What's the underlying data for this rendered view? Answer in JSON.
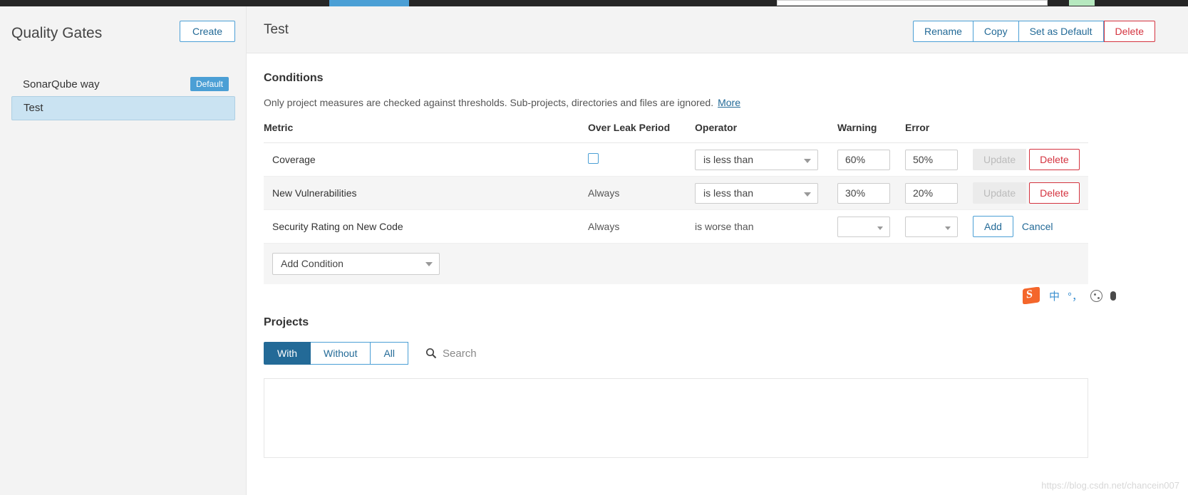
{
  "topbar": {
    "active_tab_name": "quality-gates-tab",
    "search_placeholder": "",
    "accent_blue": "#4b9fd5",
    "bar_color": "#262626"
  },
  "sidebar": {
    "title": "Quality Gates",
    "create_label": "Create",
    "gates": [
      {
        "name": "SonarQube way",
        "badge": "Default",
        "selected": false
      },
      {
        "name": "Test",
        "badge": "",
        "selected": true
      }
    ]
  },
  "header": {
    "gate_name": "Test",
    "actions": [
      {
        "label": "Rename",
        "style": "default"
      },
      {
        "label": "Copy",
        "style": "default"
      },
      {
        "label": "Set as Default",
        "style": "default"
      },
      {
        "label": "Delete",
        "style": "danger"
      }
    ]
  },
  "conditions": {
    "title": "Conditions",
    "description": "Only project measures are checked against thresholds. Sub-projects, directories and files are ignored.",
    "more_link": "More",
    "columns": {
      "metric": "Metric",
      "leak": "Over Leak Period",
      "operator": "Operator",
      "warning": "Warning",
      "error": "Error"
    },
    "rows": [
      {
        "metric": "Coverage",
        "leak_checkbox": true,
        "leak_checked": false,
        "leak_text": "",
        "operator": "is less than",
        "operator_editable": true,
        "warning": "60%",
        "error": "50%",
        "warning_editable": true,
        "error_editable": true,
        "primary_action": "Update",
        "primary_disabled": true,
        "secondary_action": "Delete",
        "secondary_style": "danger"
      },
      {
        "metric": "New Vulnerabilities",
        "leak_checkbox": false,
        "leak_checked": false,
        "leak_text": "Always",
        "operator": "is less than",
        "operator_editable": true,
        "warning": "30%",
        "error": "20%",
        "warning_editable": true,
        "error_editable": true,
        "primary_action": "Update",
        "primary_disabled": true,
        "secondary_action": "Delete",
        "secondary_style": "danger"
      },
      {
        "metric": "Security Rating on New Code",
        "leak_checkbox": false,
        "leak_checked": false,
        "leak_text": "Always",
        "operator": "is worse than",
        "operator_editable": false,
        "warning": "",
        "error": "",
        "warning_editable": false,
        "error_editable": false,
        "primary_action": "Add",
        "primary_disabled": false,
        "secondary_action": "Cancel",
        "secondary_style": "link"
      }
    ],
    "add_condition_label": "Add Condition"
  },
  "projects": {
    "title": "Projects",
    "filters": [
      {
        "label": "With",
        "active": true
      },
      {
        "label": "Without",
        "active": false
      },
      {
        "label": "All",
        "active": false
      }
    ],
    "search_placeholder": "Search"
  },
  "ime": {
    "logo_letter": "S",
    "mode_label": "中",
    "punct_label": "°，",
    "emoji_label": "☺",
    "mic_label": "mic"
  },
  "watermark": "https://blog.csdn.net/chancein007"
}
